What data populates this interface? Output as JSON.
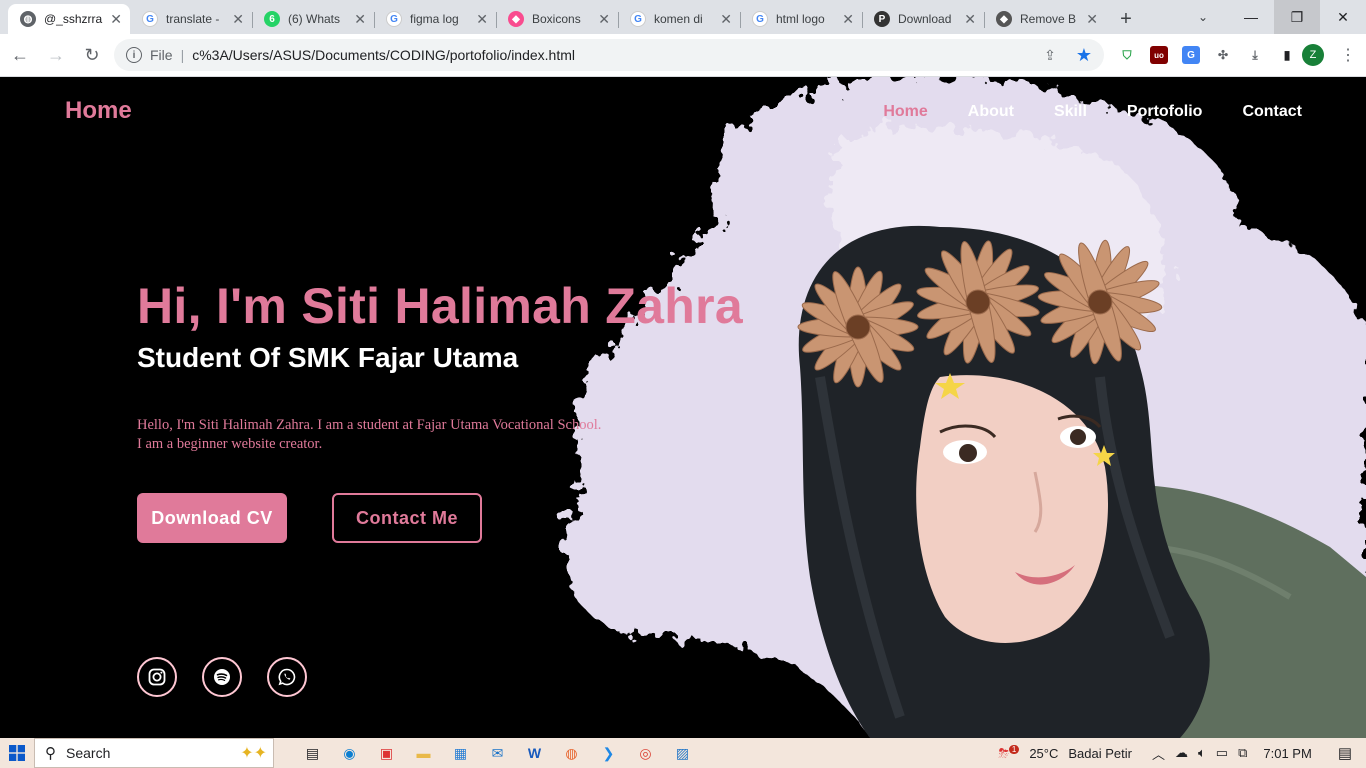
{
  "browser": {
    "tabs": [
      {
        "title": "@_sshzrra",
        "icon": "globe-icon",
        "active": true
      },
      {
        "title": "translate -",
        "icon": "google-icon",
        "active": false
      },
      {
        "title": "(6) Whats",
        "icon": "whatsapp-icon",
        "active": false
      },
      {
        "title": "figma log",
        "icon": "google-icon",
        "active": false
      },
      {
        "title": "Boxicons",
        "icon": "boxicons-icon",
        "active": false
      },
      {
        "title": "komen di",
        "icon": "google-icon",
        "active": false
      },
      {
        "title": "html logo",
        "icon": "google-icon",
        "active": false
      },
      {
        "title": "Download",
        "icon": "png-icon",
        "active": false
      },
      {
        "title": "Remove B",
        "icon": "removebg-icon",
        "active": false
      }
    ],
    "address": {
      "scheme": "File",
      "url": "c%3A/Users/ASUS/Documents/CODING/portofolio/index.html"
    },
    "profile_initial": "Z"
  },
  "site": {
    "logo": "Home",
    "nav": [
      {
        "label": "Home",
        "current": true
      },
      {
        "label": "About",
        "current": false
      },
      {
        "label": "Skill",
        "current": false
      },
      {
        "label": "Portofolio",
        "current": false
      },
      {
        "label": "Contact",
        "current": false
      }
    ],
    "hero": {
      "title": "Hi, I'm Siti Halimah Zahra",
      "subtitle": "Student Of SMK Fajar Utama",
      "desc_line1": "Hello, I'm Siti Halimah Zahra. I am a student at Fajar Utama Vocational School.",
      "desc_line2": "I am a beginner website creator.",
      "btn_download": "Download CV",
      "btn_contact": "Contact Me"
    },
    "social": [
      "instagram-icon",
      "spotify-icon",
      "whatsapp-icon"
    ],
    "accent_color": "#e07a9a"
  },
  "taskbar": {
    "search_label": "Search",
    "weather_temp": "25°C",
    "weather_desc": "Badai Petir",
    "time": "7:01 PM",
    "weather_badge": "1"
  }
}
